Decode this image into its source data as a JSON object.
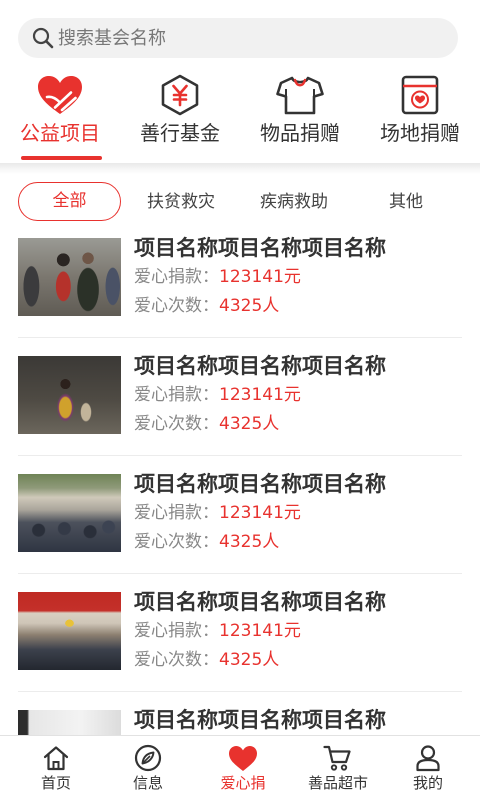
{
  "colors": {
    "accent": "#e8322e",
    "text": "#333333",
    "muted": "#888888"
  },
  "search": {
    "placeholder": "搜索基会名称",
    "icon": "search-icon"
  },
  "categories": [
    {
      "label": "公益项目",
      "icon": "heart-hand-icon",
      "active": true
    },
    {
      "label": "善行基金",
      "icon": "yuan-hexagon-icon",
      "active": false
    },
    {
      "label": "物品捐赠",
      "icon": "tshirt-icon",
      "active": false
    },
    {
      "label": "场地捐赠",
      "icon": "heart-box-icon",
      "active": false
    }
  ],
  "filters": [
    {
      "label": "全部",
      "active": true
    },
    {
      "label": "扶贫救灾",
      "active": false
    },
    {
      "label": "疾病救助",
      "active": false
    },
    {
      "label": "其他",
      "active": false
    }
  ],
  "projects": [
    {
      "title": "项目名称项目名称项目名称",
      "donation_label": "爱心捐款：",
      "donation_value": "123141元",
      "count_label": "爱心次数：",
      "count_value": "4325人"
    },
    {
      "title": "项目名称项目名称项目名称",
      "donation_label": "爱心捐款：",
      "donation_value": "123141元",
      "count_label": "爱心次数：",
      "count_value": "4325人"
    },
    {
      "title": "项目名称项目名称项目名称",
      "donation_label": "爱心捐款：",
      "donation_value": "123141元",
      "count_label": "爱心次数：",
      "count_value": "4325人"
    },
    {
      "title": "项目名称项目名称项目名称",
      "donation_label": "爱心捐款：",
      "donation_value": "123141元",
      "count_label": "爱心次数：",
      "count_value": "4325人"
    },
    {
      "title": "项目名称项目名称项目名称"
    }
  ],
  "bottom_nav": [
    {
      "label": "首页",
      "icon": "home-icon",
      "active": false
    },
    {
      "label": "信息",
      "icon": "compass-icon",
      "active": false
    },
    {
      "label": "爱心捐",
      "icon": "heart-icon",
      "active": true
    },
    {
      "label": "善品超市",
      "icon": "cart-icon",
      "active": false
    },
    {
      "label": "我的",
      "icon": "user-icon",
      "active": false
    }
  ]
}
